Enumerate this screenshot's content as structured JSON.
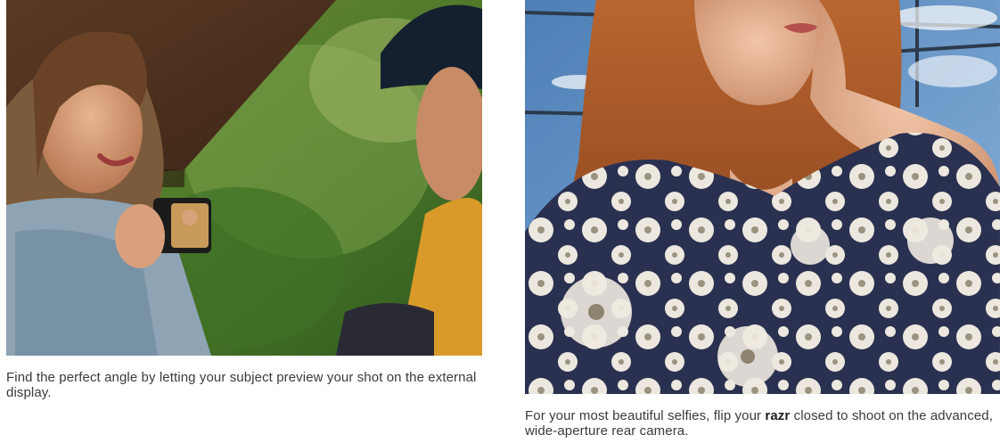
{
  "cards": [
    {
      "image_alt": "Woman holding a flip phone showing a man his preview on the external display",
      "caption": "Find the perfect angle by letting your subject preview your shot on the external display."
    },
    {
      "image_alt": "Woman with long red hair in a floral jacket taking a selfie",
      "caption_before": "For your most beautiful selfies, flip your ",
      "caption_brand": "razr",
      "caption_after": " closed to shoot on the advanced, wide-aperture rear camera."
    }
  ]
}
